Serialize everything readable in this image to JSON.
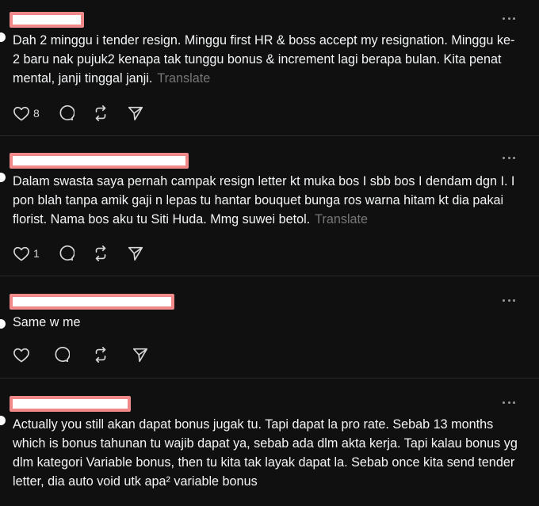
{
  "posts": [
    {
      "text": "Dah 2 minggu i tender resign. Minggu first HR & boss accept my resignation. Minggu ke-2 baru nak pujuk2 kenapa tak tunggu bonus & increment lagi berapa bulan. Kita penat mental, janji tinggal janji.",
      "translate_label": "Translate",
      "like_count": "8"
    },
    {
      "text": "Dalam swasta saya pernah campak resign letter kt muka bos I sbb bos I dendam dgn I. I pon blah tanpa amik gaji n lepas tu hantar bouquet bunga ros warna hitam kt dia pakai florist. Nama bos aku tu Siti Huda. Mmg suwei betol.",
      "translate_label": "Translate",
      "like_count": "1"
    },
    {
      "text": "Same w me",
      "translate_label": "",
      "like_count": ""
    },
    {
      "text": "Actually you still akan dapat bonus jugak tu. Tapi dapat la pro rate. Sebab 13 months which is bonus tahunan tu wajib dapat ya, sebab ada dlm akta kerja. Tapi kalau bonus yg dlm kategori Variable bonus, then tu kita tak layak dapat la. Sebab once kita send tender letter, dia auto void utk apa² variable bonus",
      "translate_label": "",
      "like_count": ""
    }
  ],
  "icons": {
    "like": "heart-icon",
    "reply": "comment-icon",
    "repost": "repost-icon",
    "share": "send-icon",
    "more": "more-icon"
  },
  "colors": {
    "background": "#101010",
    "text": "#f3f5f7",
    "muted": "#777777",
    "redaction_border": "#f08a8a"
  }
}
